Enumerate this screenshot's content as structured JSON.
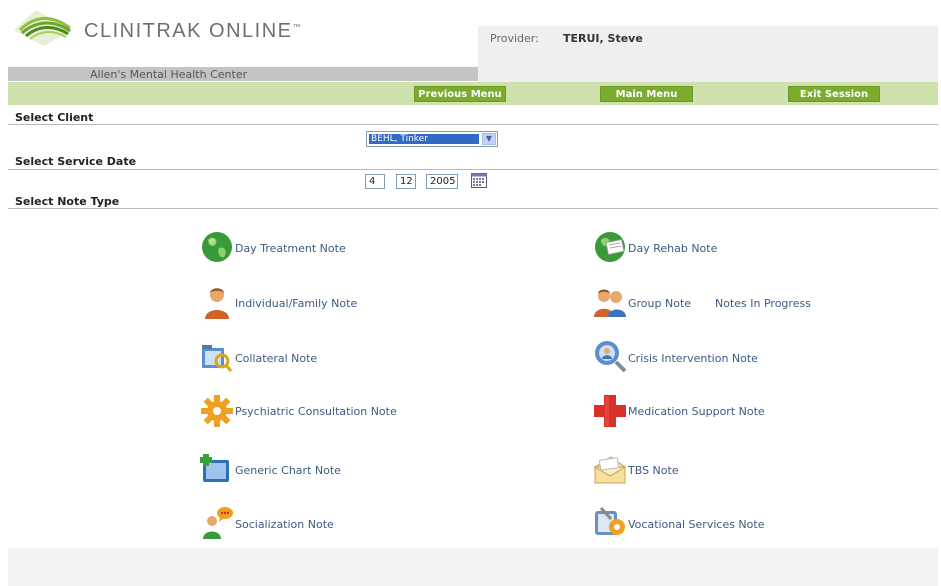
{
  "header": {
    "logo_text": "CLINITRAK ONLINE",
    "logo_tm": "™",
    "provider_label": "Provider:",
    "provider_name": "TERUI, Steve",
    "center_name": "Allen's Mental Health Center"
  },
  "nav": {
    "previous_menu": "Previous Menu",
    "main_menu": "Main Menu",
    "exit_session": "Exit Session"
  },
  "sections": {
    "select_client": "Select Client",
    "select_service_date": "Select Service Date",
    "select_note_type": "Select Note Type"
  },
  "client": {
    "selected": "BEHL, Tinker"
  },
  "service_date": {
    "month": "4",
    "day": "12",
    "year": "2005"
  },
  "notes": {
    "day_treatment": "Day Treatment Note",
    "day_rehab": "Day Rehab Note",
    "individual_family": "Individual/Family Note",
    "group": "Group Note",
    "notes_in_progress": "Notes In Progress",
    "collateral": "Collateral Note",
    "crisis_intervention": "Crisis Intervention Note",
    "psychiatric_consultation": "Psychiatric Consultation Note",
    "medication_support": "Medication Support Note",
    "generic_chart": "Generic Chart Note",
    "tbs": "TBS Note",
    "socialization": "Socialization Note",
    "vocational_services": "Vocational Services Note"
  },
  "colors": {
    "nav_bar": "#cfe1ac",
    "nav_button": "#7cac2e",
    "link": "#3b5b82",
    "selection": "#316ac5"
  },
  "icons": {
    "logo": "clinitrak-logo-icon",
    "calendar": "calendar-icon",
    "dropdown": "chevron-down-icon"
  }
}
